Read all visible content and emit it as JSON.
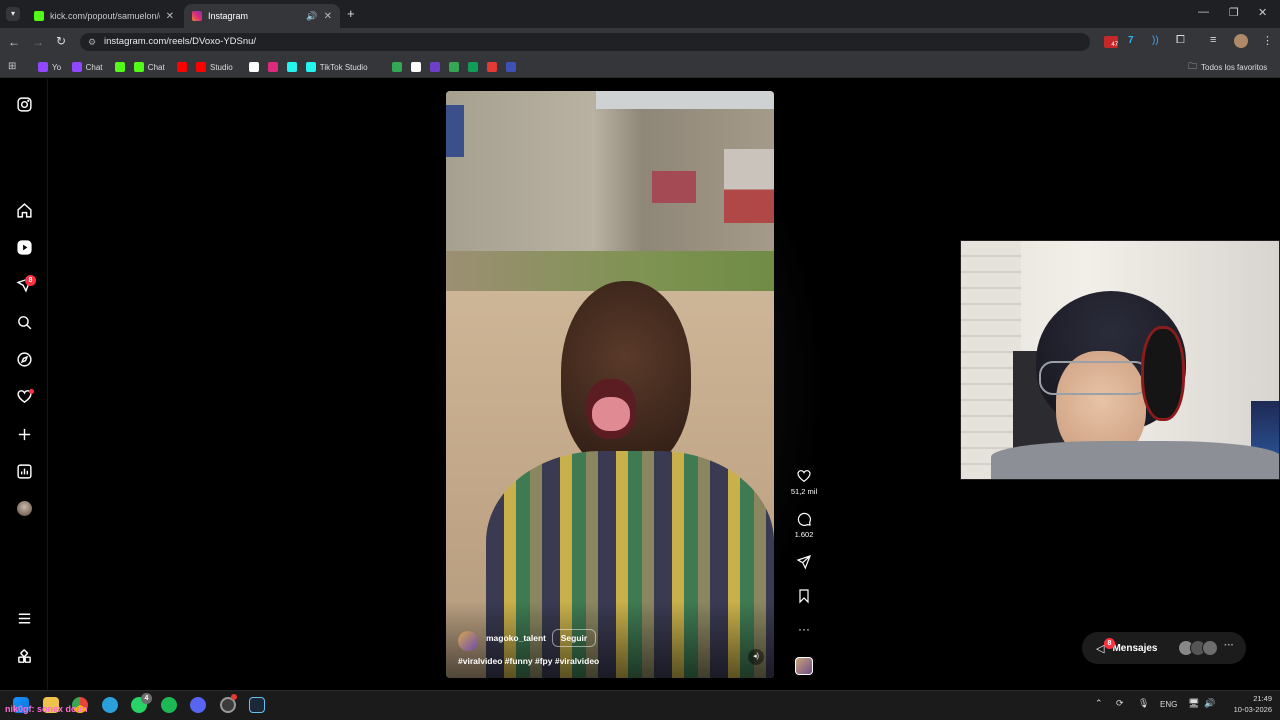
{
  "browser": {
    "tabs": [
      {
        "title": "kick.com/popout/samuelon/chat",
        "favicon_color": "#53fc18",
        "active": false
      },
      {
        "title": "Instagram",
        "favicon_color": "#dd2a7b",
        "active": true
      }
    ],
    "url": "instagram.com/reels/DVoxo-YDSnu/",
    "bookmarks": [
      {
        "label": "Yo",
        "color": "#9146ff"
      },
      {
        "label": "Chat",
        "color": "#9146ff"
      },
      {
        "label": "",
        "color": "#53fc18"
      },
      {
        "label": "Chat",
        "color": "#53fc18"
      },
      {
        "label": "",
        "color": "#ff0000"
      },
      {
        "label": "Studio",
        "color": "#ff0000"
      },
      {
        "label": "",
        "color": "#ffffff"
      },
      {
        "label": "",
        "color": "#dd2a7b"
      },
      {
        "label": "",
        "color": "#25f4ee"
      },
      {
        "label": "TikTok Studio",
        "color": "#25f4ee"
      },
      {
        "label": "",
        "color": "#34a853"
      },
      {
        "label": "",
        "color": "#ffffff"
      },
      {
        "label": "",
        "color": "#6e40c9"
      },
      {
        "label": "",
        "color": "#34a853"
      },
      {
        "label": "",
        "color": "#0f9d58"
      },
      {
        "label": "",
        "color": "#e53935"
      },
      {
        "label": "",
        "color": "#3f51b5"
      }
    ],
    "all_bookmarks_label": "Todos los favoritos",
    "extension_badge": "47"
  },
  "sidenav": {
    "notification_badge": "8"
  },
  "reel": {
    "username": "magoko_talent",
    "follow_label": "Seguir",
    "caption": "#viralvideo #funny #fpy #viralvideo",
    "likes": "51,2 mil",
    "comments": "1.602"
  },
  "messages": {
    "label": "Mensajes",
    "badge": "8"
  },
  "taskbar": {
    "overlay_text": "nik0gf: sonex doun",
    "whatsapp_badge": "4",
    "language": "ENG",
    "time": "21:49",
    "date": "10-03-2026"
  },
  "colors": {
    "accent_red": "#ff3040",
    "background": "#000000"
  }
}
